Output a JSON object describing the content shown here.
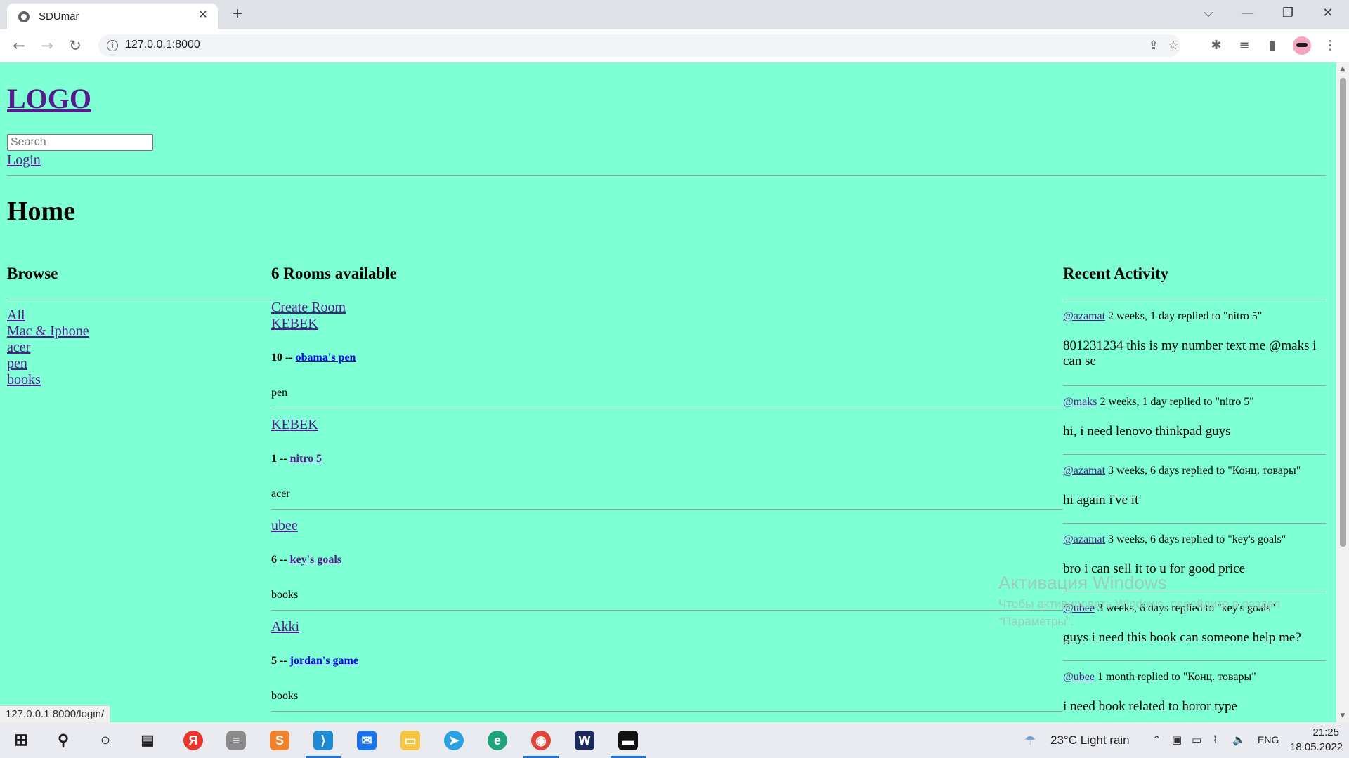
{
  "browser": {
    "tab_title": "SDUmar",
    "url": "127.0.0.1:8000",
    "status_url": "127.0.0.1:8000/login/"
  },
  "icons": {
    "favicon": "globe-icon",
    "back": "arrow-left-icon",
    "forward": "arrow-right-icon",
    "reload": "reload-icon",
    "share": "share-icon",
    "bookmark": "star-icon",
    "extensions": "puzzle-icon",
    "media": "media-queue-icon",
    "sidepanel": "side-panel-icon",
    "menu": "kebab-menu-icon"
  },
  "header": {
    "logo": "LOGO",
    "search_placeholder": "Search",
    "login": "Login"
  },
  "main": {
    "page_title": "Home"
  },
  "browse": {
    "heading": "Browse",
    "topics": [
      "All",
      "Mac & Iphone",
      "acer",
      "pen",
      "books"
    ]
  },
  "rooms": {
    "heading": "6 Rooms available",
    "create_label": "Create Room",
    "items": [
      {
        "host": "KEBEK",
        "count": "10",
        "sep": "--",
        "name": "obama's pen",
        "topic": "pen"
      },
      {
        "host": "KEBEK",
        "count": "1",
        "sep": "--",
        "name": "nitro 5",
        "topic": "acer"
      },
      {
        "host": "ubee",
        "count": "6",
        "sep": "--",
        "name": "key's goals",
        "topic": "books"
      },
      {
        "host": "Akki",
        "count": "5",
        "sep": "--",
        "name": "jordan's game",
        "topic": "books"
      }
    ]
  },
  "activity": {
    "heading": "Recent Activity",
    "items": [
      {
        "user": "@azamat",
        "meta": "2 weeks, 1 day replied to \"nitro 5\"",
        "body": "801231234 this is my number text me @maks i can se"
      },
      {
        "user": "@maks",
        "meta": "2 weeks, 1 day replied to \"nitro 5\"",
        "body": "hi, i need lenovo thinkpad guys"
      },
      {
        "user": "@azamat",
        "meta": "3 weeks, 6 days replied to \"Конц. товары\"",
        "body": "hi again i've it"
      },
      {
        "user": "@azamat",
        "meta": "3 weeks, 6 days replied to \"key's goals\"",
        "body": "bro i can sell it to u for good price"
      },
      {
        "user": "@ubee",
        "meta": "3 weeks, 6 days replied to \"key's goals\"",
        "body": "guys i need this book can someone help me?"
      },
      {
        "user": "@ubee",
        "meta": "1 month replied to \"Конц. товары\"",
        "body": "i need book related to horor type"
      }
    ]
  },
  "watermark": {
    "title": "Активация Windows",
    "text": "Чтобы активировать Windows, перейдите в раздел \"Параметры\"."
  },
  "taskbar": {
    "weather": "23°C  Light rain",
    "lang": "ENG",
    "time": "21:25",
    "date": "18.05.2022"
  },
  "colors": {
    "page_bg": "#7fffd4",
    "link": "#551a8b"
  }
}
